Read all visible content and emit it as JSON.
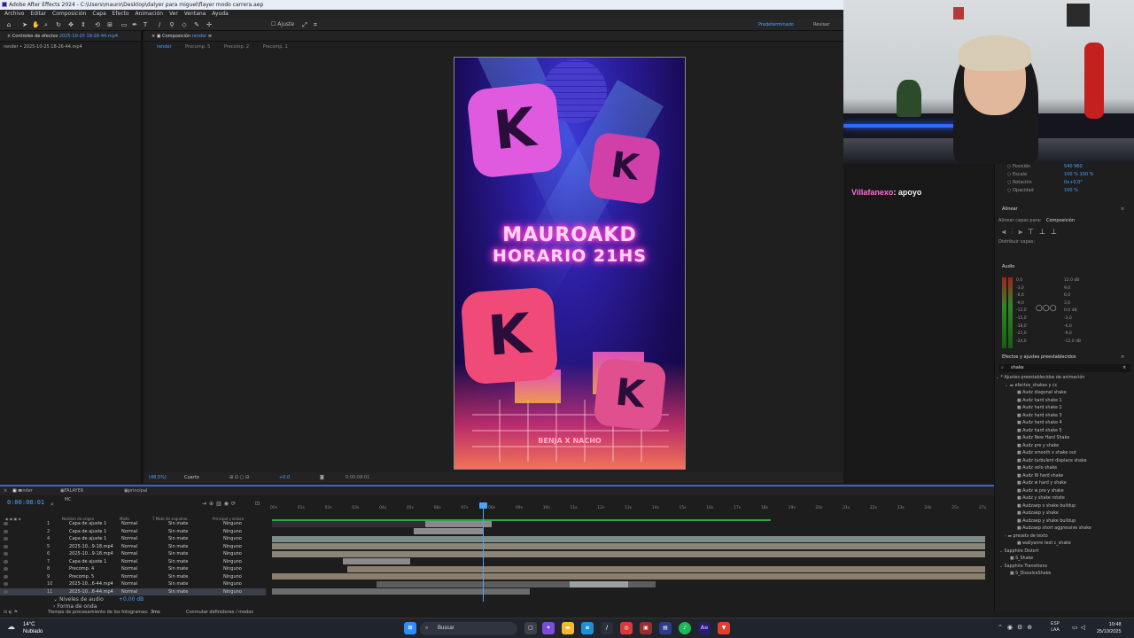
{
  "window": {
    "title": "Adobe After Effects 2024 - C:\\Users\\mauro\\Desktop\\dalyer para miguel\\flayer modo carrera.aep"
  },
  "menu": [
    "Archivo",
    "Editar",
    "Composición",
    "Capa",
    "Efecto",
    "Animación",
    "Ver",
    "Ventana",
    "Ayuda"
  ],
  "toolbar": {
    "ajuste_label": "Ajuste",
    "workspace": "Predeterminado",
    "review": "Revisar"
  },
  "effects_panel": {
    "tab": "Controles de efectos",
    "tab_file": "2025-10-25 18-26-44.mp4",
    "subtitle": "render • 2025-10-25 18-26-44.mp4"
  },
  "comp_panel": {
    "tab": "Composición",
    "tab_name": "render",
    "sub_tabs": [
      "render",
      "Precomp. 5",
      "Precomp. 2",
      "Precomp. 1"
    ],
    "viewer": {
      "title_line1": "MAUROAKD",
      "title_line2": "HORARIO 21HS",
      "footer": "BENJA X NACHO"
    },
    "zoom": "(48,5%)",
    "quality": "Cuarto",
    "offset": "+0.0",
    "time": "0:00:08:01"
  },
  "chat": {
    "user": "Villafanexo",
    "text": ": apoyo"
  },
  "properties": {
    "items": [
      "Posición",
      "Escala",
      "Rotación",
      "Opacidad"
    ],
    "values": [
      "540 960",
      "100 % 100 %",
      "0x+0,0°",
      "100 %"
    ]
  },
  "align": {
    "title": "Alinear",
    "align_to_label": "Alinear capas para:",
    "align_to_value": "Composición",
    "distribute": "Distribuir capas:"
  },
  "audio": {
    "title": "Audio",
    "left_scale": [
      "0,0",
      "-3,0",
      "-6,0",
      "-9,0",
      "-12,0",
      "-15,0",
      "-18,0",
      "-21,0",
      "-24,0"
    ],
    "right_scale": [
      "12,0 dB",
      "9,0",
      "6,0",
      "3,0",
      "0,0 dB",
      "-3,0",
      "-6,0",
      "-9,0",
      "-12,0 dB"
    ]
  },
  "effects_presets": {
    "title": "Efectos y ajustes preestablecidos",
    "search_value": "shake",
    "root": "* Ajustes preestablecidos de animación",
    "folder1": "efectos_shakes y cc",
    "items": [
      "Audz diagonal shake",
      "Audz hard shake 1",
      "Audz hard shake 2",
      "Audz hard shake 3",
      "Audz hard shake 4",
      "Audz hard shake 5",
      "Audz New Hard Shake",
      "Audz pre y shake",
      "Audz smooth x shake out",
      "Audz turbulent displace shake",
      "Audz velo shake",
      "Audz W hard shake",
      "Audz w hard y shake",
      "Audz w pre y shake",
      "Audz y shake rotate",
      "Audzaep x shake buildup",
      "Audzaep y shake",
      "Audzaep y shake buildup",
      "Audzaep short aggressive shake"
    ],
    "folder2": "presets de texto",
    "folder2_items": [
      "wallyanre text c_shake"
    ],
    "sapphire1": "Sapphire Distort",
    "sapphire1_items": [
      "S_Shake"
    ],
    "sapphire2": "Sapphire Transitions",
    "sapphire2_items": [
      "S_DissolveShake"
    ]
  },
  "timeline": {
    "tabs": [
      "render",
      "FALAYER MC",
      "principal"
    ],
    "timecode": "0:00:08:01",
    "columns": {
      "source": "Nombre de origen",
      "mode": "Modo",
      "track": "T  Mate de seguimie...",
      "parent": "Principal y enlace"
    },
    "ruler": [
      "00s",
      "01s",
      "02s",
      "03s",
      "04s",
      "05s",
      "06s",
      "07s",
      "08s",
      "09s",
      "10s",
      "11s",
      "12s",
      "13s",
      "14s",
      "15s",
      "16s",
      "17s",
      "18s",
      "19s",
      "20s",
      "21s",
      "22s",
      "23s",
      "24s",
      "25s",
      "27s"
    ],
    "layers": [
      {
        "num": "1",
        "name": "Capa de ajuste 1",
        "mode": "Normal",
        "matte": "Sin mate",
        "parent": "Ninguno"
      },
      {
        "num": "2",
        "name": "Capa de ajuste 1",
        "mode": "Normal",
        "matte": "Sin mate",
        "parent": "Ninguno"
      },
      {
        "num": "4",
        "name": "Capa de ajuste 1",
        "mode": "Normal",
        "matte": "Sin mate",
        "parent": "Ninguno"
      },
      {
        "num": "5",
        "name": "2025-10...9-18.mp4",
        "mode": "Normal",
        "matte": "Sin mate",
        "parent": "Ninguno"
      },
      {
        "num": "6",
        "name": "2025-10...9-18.mp4",
        "mode": "Normal",
        "matte": "Sin mate",
        "parent": "Ninguno"
      },
      {
        "num": "7",
        "name": "Capa de ajuste 1",
        "mode": "Normal",
        "matte": "Sin mate",
        "parent": "Ninguno"
      },
      {
        "num": "8",
        "name": "Precomp. 4",
        "mode": "Normal",
        "matte": "Sin mate",
        "parent": "Ninguno"
      },
      {
        "num": "9",
        "name": "Precomp. 5",
        "mode": "Normal",
        "matte": "Sin mate",
        "parent": "Ninguno"
      },
      {
        "num": "10",
        "name": "2025-10...6-44.mp4",
        "mode": "Normal",
        "matte": "Sin mate",
        "parent": "Ninguno"
      },
      {
        "num": "11",
        "name": "2025-10...6-44.mp4",
        "mode": "Normal",
        "matte": "Sin mate",
        "parent": "Ninguno"
      }
    ],
    "audio_levels": "Niveles de audio",
    "audio_value": "+0,00 dB",
    "waveform": "Forma de onda"
  },
  "status": {
    "label": "Tiempo de procesamiento de los fotogramas:",
    "value": "3ms",
    "toggle": "Conmutar definidores / modos"
  },
  "taskbar": {
    "weather_temp": "14°C",
    "weather_desc": "Nublado",
    "search_placeholder": "Buscar",
    "lang1": "ESP",
    "lang2": "LAA",
    "time": "10:48",
    "date": "25/10/2025"
  },
  "colors": {
    "accent": "#4aa4ff",
    "neon_pink": "#ff3bd1",
    "timeline_border": "#2b6dd8"
  }
}
